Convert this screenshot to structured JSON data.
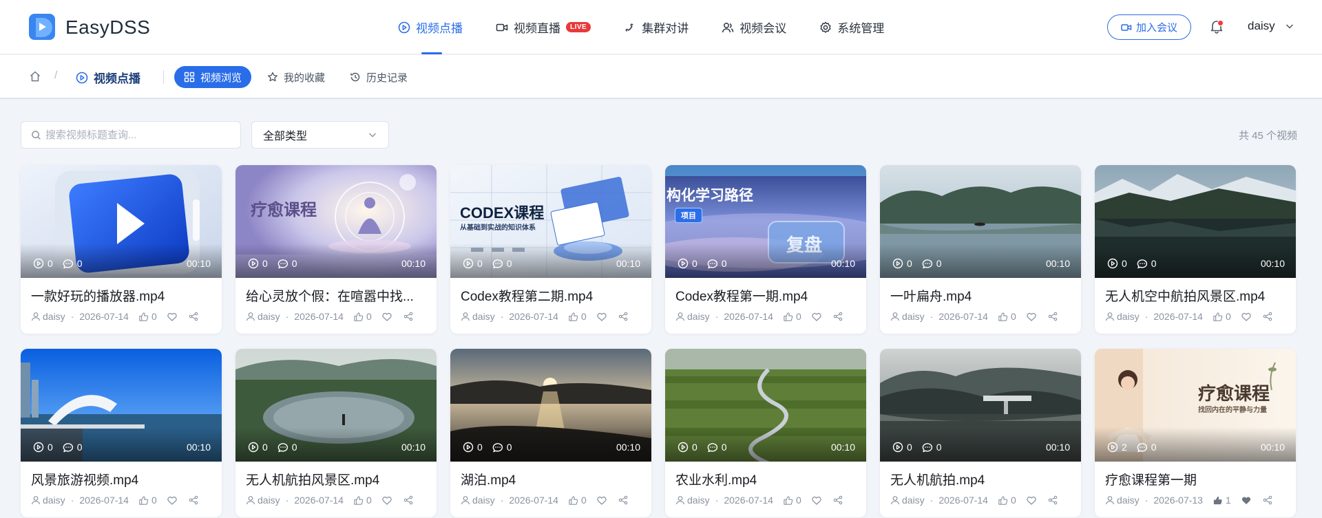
{
  "app": {
    "brand": "EasyDSS"
  },
  "nav": {
    "items": [
      {
        "label": "视频点播",
        "icon": "play-circle-icon"
      },
      {
        "label": "视频直播",
        "icon": "video-camera-icon",
        "badge": "LIVE"
      },
      {
        "label": "集群对讲",
        "icon": "phone-icon"
      },
      {
        "label": "视频会议",
        "icon": "users-icon"
      },
      {
        "label": "系统管理",
        "icon": "gear-icon"
      }
    ],
    "active_index": 0
  },
  "header": {
    "join_label": "加入会议",
    "username": "daisy"
  },
  "breadcrumb": {
    "separator": "/",
    "current": "视频点播"
  },
  "subtabs": [
    {
      "label": "视频浏览",
      "icon": "grid-icon"
    },
    {
      "label": "我的收藏",
      "icon": "star-icon"
    },
    {
      "label": "历史记录",
      "icon": "history-icon"
    }
  ],
  "filters": {
    "search_placeholder": "搜索视频标题查询...",
    "category_selected": "全部类型",
    "total": "共 45 个视频"
  },
  "videos": [
    {
      "title": "一款好玩的播放器.mp4",
      "plays": "0",
      "comments": "0",
      "duration": "00:10",
      "author": "daisy",
      "date": "2026-07-14",
      "likes": "0",
      "thumb": "player"
    },
    {
      "title": "给心灵放个假：在喧嚣中找...",
      "plays": "0",
      "comments": "0",
      "duration": "00:10",
      "author": "daisy",
      "date": "2026-07-14",
      "likes": "0",
      "thumb": "meditation",
      "thumb_title": "疗愈课程"
    },
    {
      "title": "Codex教程第二期.mp4",
      "plays": "0",
      "comments": "0",
      "duration": "00:10",
      "author": "daisy",
      "date": "2026-07-14",
      "likes": "0",
      "thumb": "codex",
      "thumb_title": "CODEX课程",
      "thumb_sub": "从基础到实战的知识体系"
    },
    {
      "title": "Codex教程第一期.mp4",
      "plays": "0",
      "comments": "0",
      "duration": "00:10",
      "author": "daisy",
      "date": "2026-07-14",
      "likes": "0",
      "thumb": "course",
      "thumb_title": "构化学习路径",
      "thumb_tag": "项目",
      "thumb_btn": "复盘"
    },
    {
      "title": "一叶扁舟.mp4",
      "plays": "0",
      "comments": "0",
      "duration": "00:10",
      "author": "daisy",
      "date": "2026-07-14",
      "likes": "0",
      "thumb": "lake1"
    },
    {
      "title": "无人机空中航拍风景区.mp4",
      "plays": "0",
      "comments": "0",
      "duration": "00:10",
      "author": "daisy",
      "date": "2026-07-14",
      "likes": "0",
      "thumb": "lake2"
    },
    {
      "title": "风景旅游视频.mp4",
      "plays": "0",
      "comments": "0",
      "duration": "00:10",
      "author": "daisy",
      "date": "2026-07-14",
      "likes": "0",
      "thumb": "seaside"
    },
    {
      "title": "无人机航拍风景区.mp4",
      "plays": "0",
      "comments": "0",
      "duration": "00:10",
      "author": "daisy",
      "date": "2026-07-14",
      "likes": "0",
      "thumb": "pond"
    },
    {
      "title": "湖泊.mp4",
      "plays": "0",
      "comments": "0",
      "duration": "00:10",
      "author": "daisy",
      "date": "2026-07-14",
      "likes": "0",
      "thumb": "sunset"
    },
    {
      "title": "农业水利.mp4",
      "plays": "0",
      "comments": "0",
      "duration": "00:10",
      "author": "daisy",
      "date": "2026-07-14",
      "likes": "0",
      "thumb": "fields"
    },
    {
      "title": "无人机航拍.mp4",
      "plays": "0",
      "comments": "0",
      "duration": "00:10",
      "author": "daisy",
      "date": "2026-07-14",
      "likes": "0",
      "thumb": "foggy"
    },
    {
      "title": "疗愈课程第一期",
      "plays": "2",
      "comments": "0",
      "duration": "00:10",
      "author": "daisy",
      "date": "2026-07-13",
      "likes": "1",
      "liked": true,
      "thumb": "healing",
      "thumb_title": "疗愈课程",
      "thumb_sub": "找回内在的平静与力量"
    }
  ],
  "colors": {
    "primary": "#2a6de8",
    "live": "#e8393a"
  }
}
